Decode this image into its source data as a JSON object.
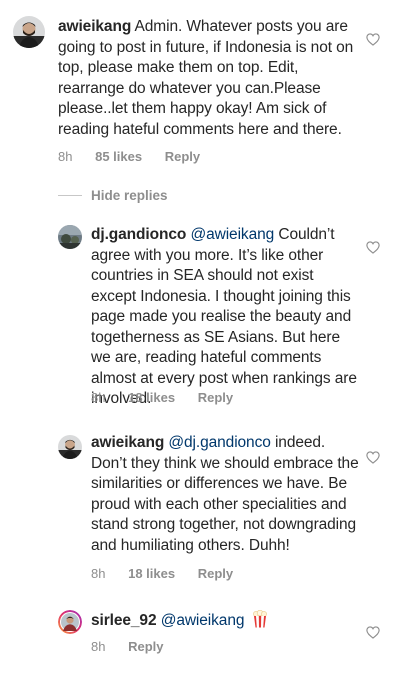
{
  "comments": [
    {
      "username": "awieikang",
      "text": "Admin. Whatever posts you are going to post in future, if Indonesia is not on top, please make them on top. Edit, rearrange do whatever you can.Please please..let them happy okay! Am sick of reading hateful comments here and there.",
      "time": "8h",
      "likes": "85 likes",
      "reply_label": "Reply",
      "avatar_icon": "profile-photo"
    }
  ],
  "hide_replies_label": "Hide replies",
  "replies": [
    {
      "username": "dj.gandionco",
      "mention": "@awieikang",
      "text": " Couldn’t agree with you more. It’s like other countries in SEA should not exist except Indonesia. I thought joining this page made you realise the beauty and togetherness as SE Asians. But here we are, reading hateful comments almost at every post when rankings are involved.",
      "time": "8h",
      "likes": "18 likes",
      "reply_label": "Reply"
    },
    {
      "username": "awieikang",
      "mention": "@dj.gandionco",
      "text": " indeed. Don’t they think we should embrace the similarities or differences we have. Be proud with each other specialities and stand strong together, not downgrading and humiliating others. Duhh!",
      "time": "8h",
      "likes": "18 likes",
      "reply_label": "Reply"
    },
    {
      "username": "sirlee_92",
      "mention": "@awieikang",
      "text": "",
      "emoji": "popcorn-emoji",
      "time": "8h",
      "reply_label": "Reply"
    }
  ],
  "colors": {
    "text": "#262626",
    "secondary": "#8e8e8e",
    "mention": "#00376b",
    "heart_outline": "#8e8e8e"
  }
}
